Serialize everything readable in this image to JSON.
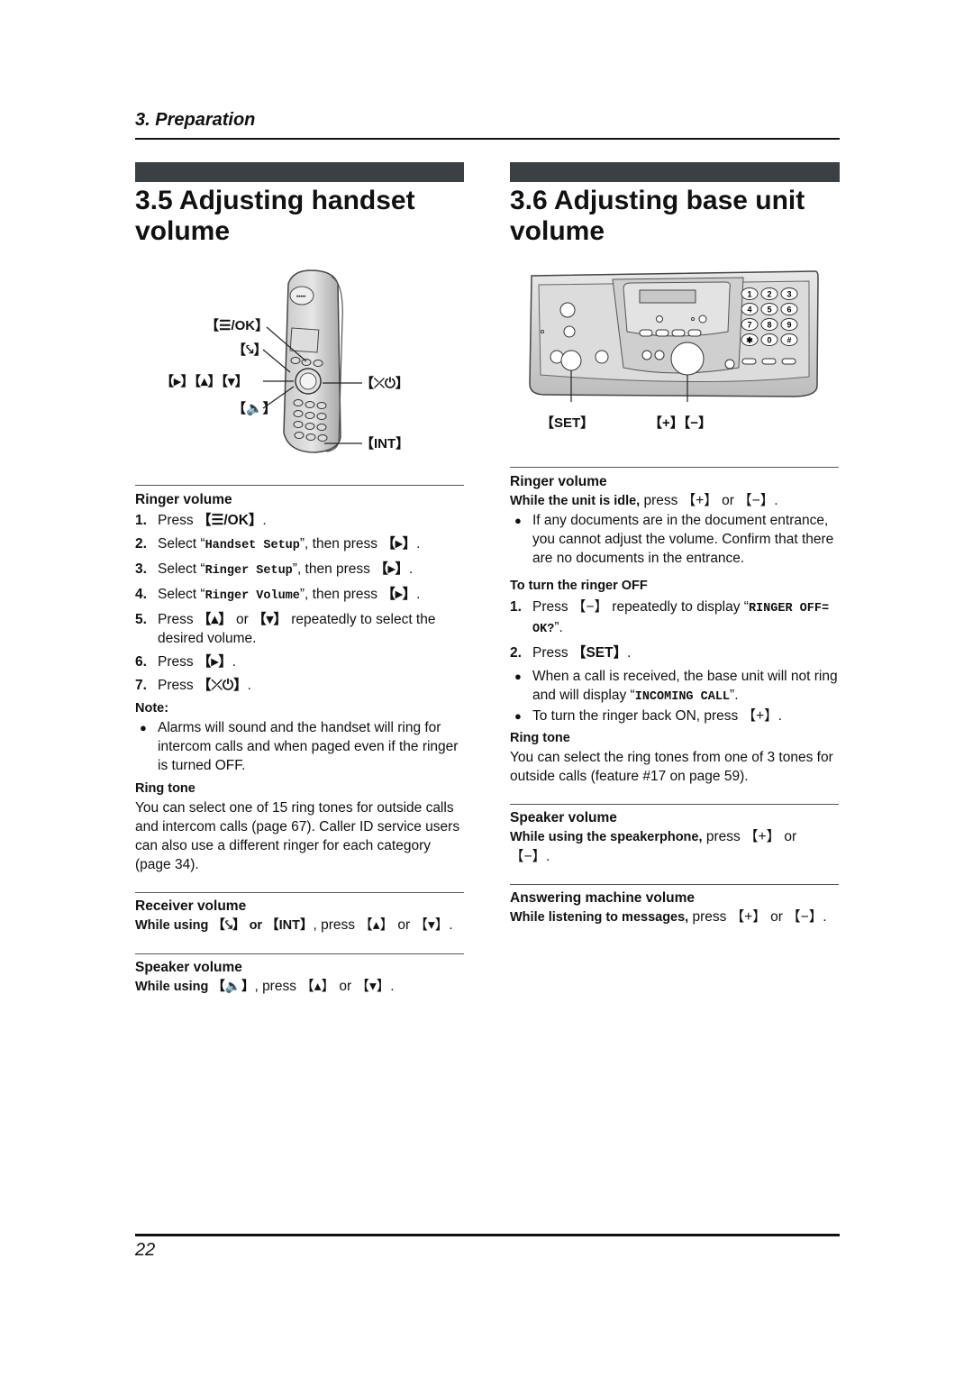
{
  "header": {
    "chapter": "3. Preparation"
  },
  "footer": {
    "page_number": "22"
  },
  "left": {
    "title_line1": "3.5 Adjusting handset",
    "title_line2": "volume",
    "figure_labels": {
      "menu_ok": "【☰/OK】",
      "talk": "【⤥】",
      "nav": "【▸】【▴】【▾】",
      "speaker": "【🔈】",
      "off_power": "【⤫⏻】",
      "int": "【INT】"
    },
    "ringer": {
      "heading": "Ringer volume",
      "steps": [
        {
          "num": "1.",
          "pre": "Press ",
          "key": "【☰/OK】",
          "mid": "",
          "code": "",
          "post": "."
        },
        {
          "num": "2.",
          "pre": "Select “",
          "code": "Handset Setup",
          "mid": "”, then press ",
          "key": "【▸】",
          "post": "."
        },
        {
          "num": "3.",
          "pre": "Select “",
          "code": "Ringer Setup",
          "mid": "”, then press ",
          "key": "【▸】",
          "post": "."
        },
        {
          "num": "4.",
          "pre": "Select “",
          "code": "Ringer Volume",
          "mid": "”, then press ",
          "key": "【▸】",
          "post": "."
        },
        {
          "num": "5.",
          "pre": "Press ",
          "key": "【▴】",
          "mid": " or ",
          "code": "【▾】",
          "post": " repeatedly to select the desired volume."
        },
        {
          "num": "6.",
          "pre": "Press ",
          "key": "【▸】",
          "mid": "",
          "code": "",
          "post": "."
        },
        {
          "num": "7.",
          "pre": "Press ",
          "key": "【⤫⏻】",
          "mid": "",
          "code": "",
          "post": "."
        }
      ],
      "note_label": "Note:",
      "note_bullets": [
        "Alarms will sound and the handset will ring for intercom calls and when paged even if the ringer is turned OFF."
      ]
    },
    "ring_tone": {
      "heading": "Ring tone",
      "body": "You can select one of 15 ring tones for outside calls and intercom calls (page 67). Caller ID service users can also use a different ringer for each category (page 34)."
    },
    "receiver": {
      "heading": "Receiver volume",
      "lead": "While using 【⤥】 or 【INT】",
      "body": ", press 【▴】 or 【▾】."
    },
    "speaker": {
      "heading": "Speaker volume",
      "lead": "While using 【🔈】",
      "body": ", press 【▴】 or 【▾】."
    }
  },
  "right": {
    "title_line1": "3.6 Adjusting base unit",
    "title_line2": "volume",
    "figure_labels": {
      "set": "【SET】",
      "plus_minus": "【+】【−】"
    },
    "keypad": [
      "1",
      "2",
      "3",
      "4",
      "5",
      "6",
      "7",
      "8",
      "9",
      "✱",
      "0",
      "#"
    ],
    "ringer": {
      "heading": "Ringer volume",
      "lead": "While the unit is idle,",
      "body": " press 【+】 or 【−】.",
      "bullets": [
        "If any documents are in the document entrance, you cannot adjust the volume. Confirm that there are no documents in the entrance."
      ]
    },
    "ringer_off": {
      "heading": "To turn the ringer OFF",
      "step1_num": "1.",
      "step1_pre": "Press 【−】 repeatedly to display “",
      "step1_code": "RINGER OFF= OK?",
      "step1_post": "”.",
      "step2_num": "2.",
      "step2_pre": "Press ",
      "step2_key": "【SET】",
      "step2_post": ".",
      "bullet1_pre": "When a call is received, the base unit will not ring and will display “",
      "bullet1_code": "INCOMING CALL",
      "bullet1_post": "”.",
      "bullet2": "To turn the ringer back ON, press 【+】."
    },
    "ring_tone": {
      "heading": "Ring tone",
      "body": "You can select the ring tones from one of 3 tones for outside calls (feature #17 on page 59)."
    },
    "speaker": {
      "heading": "Speaker volume",
      "lead": "While using the speakerphone,",
      "body": " press 【+】 or 【−】."
    },
    "answering": {
      "heading": "Answering machine volume",
      "lead": "While listening to messages,",
      "body": " press 【+】 or 【−】."
    }
  }
}
